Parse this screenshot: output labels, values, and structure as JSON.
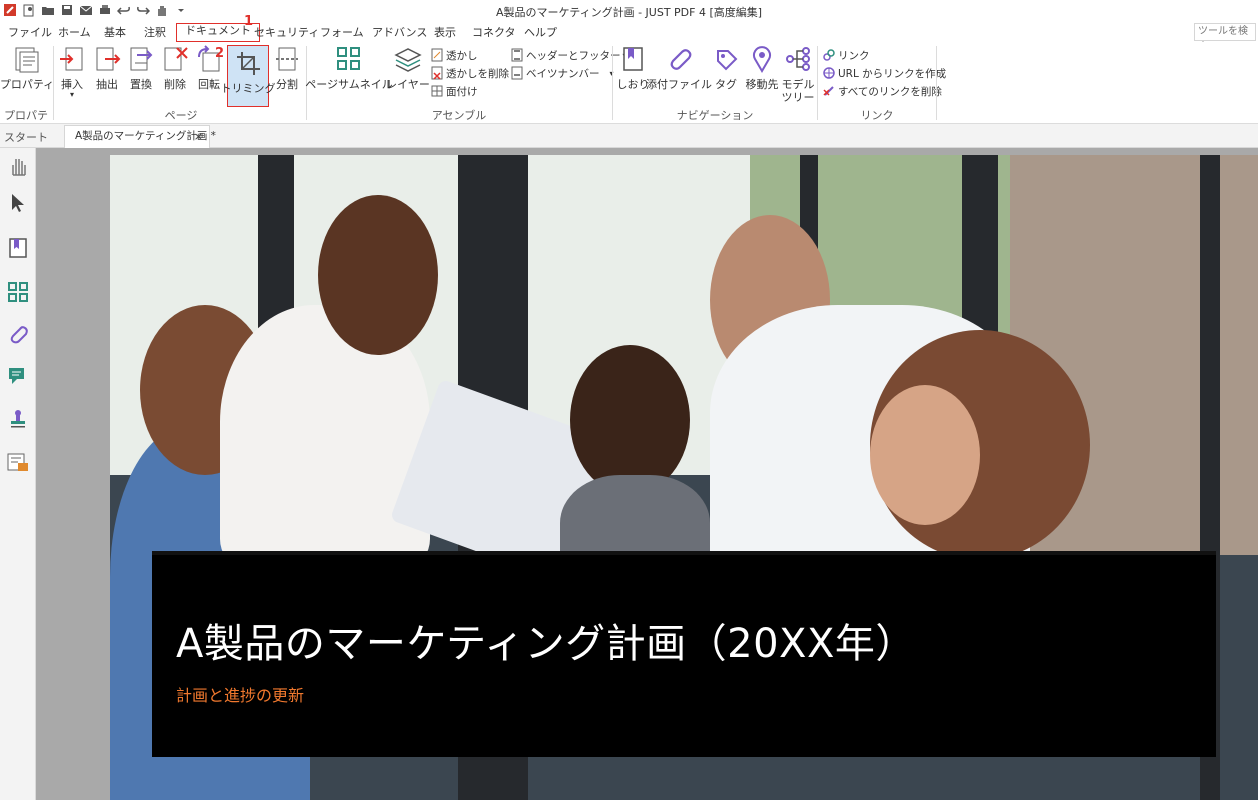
{
  "window": {
    "title": "A製品のマーケティング計画 - JUST PDF 4 [高度編集]"
  },
  "menu": {
    "items": [
      "ファイル",
      "ホーム",
      "基本",
      "注釈",
      "ドキュメント",
      "セキュリティ",
      "フォーム",
      "アドバンス",
      "表示",
      "コネクタ",
      "ヘルプ"
    ],
    "active": "ドキュメント",
    "search_placeholder": "ツールを検索"
  },
  "annotations": {
    "step1": "1",
    "step2": "2"
  },
  "ribbon": {
    "properties": {
      "button": "プロパティ",
      "group": "プロパティ"
    },
    "page": {
      "insert": "挿入",
      "extract": "抽出",
      "replace": "置換",
      "delete": "削除",
      "rotate": "回転",
      "trim": "トリミング",
      "split": "分割",
      "group": "ページ"
    },
    "assemble": {
      "thumbnail": "ページサムネイル",
      "layer": "レイヤー",
      "watermark": "透かし",
      "watermark_delete": "透かしを削除",
      "imposition": "面付け",
      "header_footer": "ヘッダーとフッター",
      "bates": "ベイツナンバー",
      "group": "アセンブル"
    },
    "navigation": {
      "bookmark": "しおり",
      "attachment": "添付ファイル",
      "tag": "タグ",
      "destination": "移動先",
      "model_tree_1": "モデル",
      "model_tree_2": "ツリー",
      "group": "ナビゲーション"
    },
    "link": {
      "link": "リンク",
      "create_from_url": "URL からリンクを作成",
      "delete_all": "すべてのリンクを削除",
      "group": "リンク"
    }
  },
  "tabs": {
    "start": "スタート",
    "document": "A製品のマーケティング計画 *",
    "close": "×"
  },
  "document": {
    "title": "A製品のマーケティング計画（20XX年）",
    "subtitle": "計画と進捗の更新"
  },
  "colors": {
    "accent_red": "#e0302b",
    "subtitle_orange": "#f0782e",
    "icon_teal": "#2f8f7f",
    "icon_purple": "#7a5bc7"
  }
}
